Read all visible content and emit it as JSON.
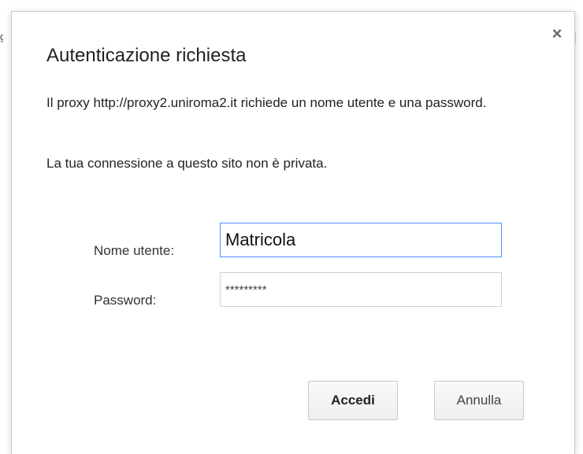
{
  "dialog": {
    "title": "Autenticazione richiesta",
    "close_label": "×",
    "message": "Il proxy http://proxy2.uniroma2.it richiede un nome utente e una password.",
    "privacy_note": "La tua connessione a questo sito non è privata."
  },
  "form": {
    "username_label": "Nome utente:",
    "username_value": "Matricola",
    "password_label": "Password:",
    "password_value": "*********"
  },
  "buttons": {
    "login_label": "Accedi",
    "cancel_label": "Annulla"
  },
  "background": {
    "sliver_text": "g"
  }
}
